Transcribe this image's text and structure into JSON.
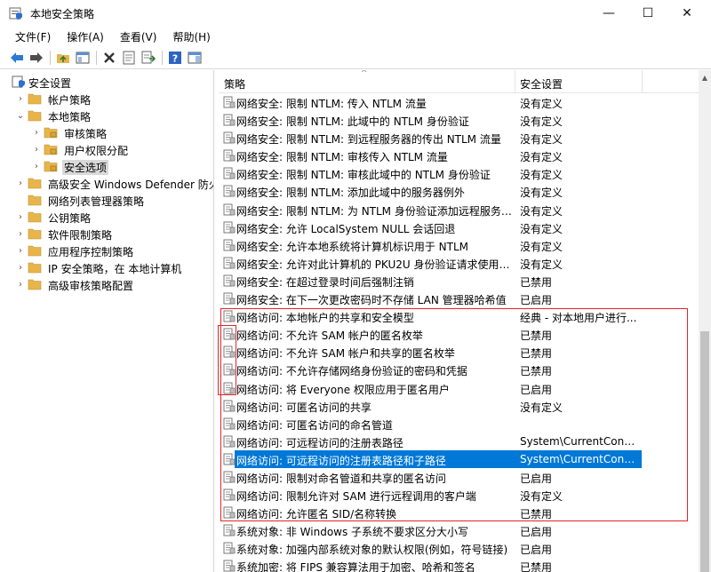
{
  "window": {
    "title": "本地安全策略",
    "controls": {
      "minimize": "—",
      "maximize": "☐",
      "close": "✕"
    },
    "app_icon": "security-policy-icon"
  },
  "menubar": [
    "文件(F)",
    "操作(A)",
    "查看(V)",
    "帮助(H)"
  ],
  "toolbar": [
    "back-icon",
    "forward-icon",
    "up-folder-icon",
    "show-hide-tree-icon",
    "delete-icon",
    "properties-icon",
    "export-list-icon",
    "help-icon",
    "action-pane-icon"
  ],
  "tree": {
    "root": "安全设置",
    "items": [
      {
        "label": "帐户策略",
        "level": 1,
        "expanded": false
      },
      {
        "label": "本地策略",
        "level": 1,
        "expanded": true
      },
      {
        "label": "审核策略",
        "level": 2,
        "expanded": false
      },
      {
        "label": "用户权限分配",
        "level": 2,
        "expanded": false
      },
      {
        "label": "安全选项",
        "level": 2,
        "expanded": false,
        "selected": true
      },
      {
        "label": "高级安全 Windows Defender 防火墙",
        "level": 1,
        "expanded": false
      },
      {
        "label": "网络列表管理器策略",
        "level": 1
      },
      {
        "label": "公钥策略",
        "level": 1,
        "expanded": false
      },
      {
        "label": "软件限制策略",
        "level": 1,
        "expanded": false
      },
      {
        "label": "应用程序控制策略",
        "level": 1,
        "expanded": false
      },
      {
        "label": "IP 安全策略，在 本地计算机",
        "level": 1,
        "expanded": false
      },
      {
        "label": "高级审核策略配置",
        "level": 1,
        "expanded": false
      }
    ]
  },
  "list": {
    "columns": [
      "策略",
      "安全设置"
    ],
    "rows": [
      {
        "policy": "网络安全: 限制 NTLM: 传入 NTLM 流量",
        "setting": "没有定义"
      },
      {
        "policy": "网络安全: 限制 NTLM: 此域中的 NTLM 身份验证",
        "setting": "没有定义"
      },
      {
        "policy": "网络安全: 限制 NTLM: 到远程服务器的传出 NTLM 流量",
        "setting": "没有定义"
      },
      {
        "policy": "网络安全: 限制 NTLM: 审核传入 NTLM 流量",
        "setting": "没有定义"
      },
      {
        "policy": "网络安全: 限制 NTLM: 审核此域中的 NTLM 身份验证",
        "setting": "没有定义"
      },
      {
        "policy": "网络安全: 限制 NTLM: 添加此域中的服务器例外",
        "setting": "没有定义"
      },
      {
        "policy": "网络安全: 限制 NTLM: 为 NTLM 身份验证添加远程服务器...",
        "setting": "没有定义"
      },
      {
        "policy": "网络安全: 允许 LocalSystem NULL 会话回退",
        "setting": "没有定义"
      },
      {
        "policy": "网络安全: 允许本地系统将计算机标识用于 NTLM",
        "setting": "没有定义"
      },
      {
        "policy": "网络安全: 允许对此计算机的 PKU2U 身份验证请求使用联...",
        "setting": "没有定义"
      },
      {
        "policy": "网络安全: 在超过登录时间后强制注销",
        "setting": "已禁用"
      },
      {
        "policy": "网络安全: 在下一次更改密码时不存储 LAN 管理器哈希值",
        "setting": "已启用"
      },
      {
        "policy": "网络访问: 本地帐户的共享和安全模型",
        "setting": "经典 - 对本地用户进行..."
      },
      {
        "policy": "网络访问: 不允许 SAM 帐户的匿名枚举",
        "setting": "已禁用"
      },
      {
        "policy": "网络访问: 不允许 SAM 帐户和共享的匿名枚举",
        "setting": "已禁用"
      },
      {
        "policy": "网络访问: 不允许存储网络身份验证的密码和凭据",
        "setting": "已禁用"
      },
      {
        "policy": "网络访问: 将 Everyone 权限应用于匿名用户",
        "setting": "已启用"
      },
      {
        "policy": "网络访问: 可匿名访问的共享",
        "setting": "没有定义"
      },
      {
        "policy": "网络访问: 可匿名访问的命名管道",
        "setting": ""
      },
      {
        "policy": "网络访问: 可远程访问的注册表路径",
        "setting": "System\\CurrentContro..."
      },
      {
        "policy": "网络访问: 可远程访问的注册表路径和子路径",
        "setting": "System\\CurrentContro...",
        "selected": true
      },
      {
        "policy": "网络访问: 限制对命名管道和共享的匿名访问",
        "setting": "已启用"
      },
      {
        "policy": "网络访问: 限制允许对 SAM 进行远程调用的客户端",
        "setting": "没有定义"
      },
      {
        "policy": "网络访问: 允许匿名 SID/名称转换",
        "setting": "已禁用"
      },
      {
        "policy": "系统对象: 非 Windows 子系统不要求区分大小写",
        "setting": "已启用"
      },
      {
        "policy": "系统对象: 加强内部系统对象的默认权限(例如，符号链接)",
        "setting": "已启用"
      },
      {
        "policy": "系统加密: 将 FIPS 兼容算法用于加密、哈希和签名",
        "setting": "已禁用"
      }
    ]
  },
  "colors": {
    "selection": "#0078d7",
    "annotation": "#e0262b",
    "folder": "#e8b54a"
  }
}
